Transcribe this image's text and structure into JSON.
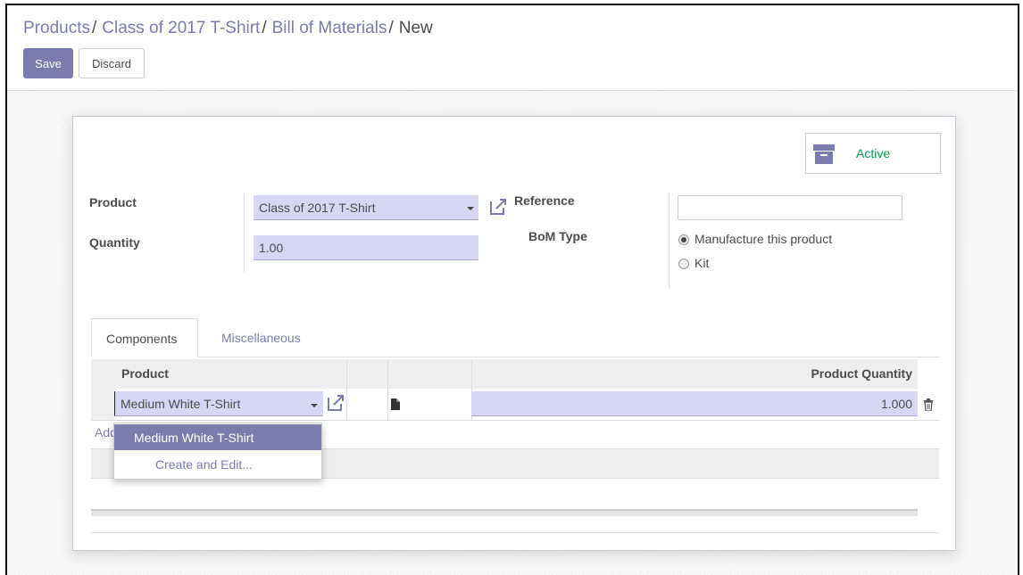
{
  "breadcrumb": {
    "items": [
      "Products",
      "Class of 2017 T-Shirt",
      "Bill of Materials"
    ],
    "current": "New",
    "separator": "/"
  },
  "toolbar": {
    "save_label": "Save",
    "discard_label": "Discard"
  },
  "status": {
    "active_label": "Active",
    "active_icon": "archive-icon"
  },
  "form": {
    "product_label": "Product",
    "product_value": "Class of 2017 T-Shirt",
    "quantity_label": "Quantity",
    "quantity_value": "1.00",
    "reference_label": "Reference",
    "reference_value": "",
    "bom_type_label": "BoM Type",
    "bom_type_options": [
      "Manufacture this product",
      "Kit"
    ],
    "bom_type_selected": "Manufacture this product"
  },
  "tabs": [
    {
      "label": "Components",
      "active": true
    },
    {
      "label": "Miscellaneous",
      "active": false
    }
  ],
  "components": {
    "columns": [
      "Product",
      "Product Quantity"
    ],
    "rows": [
      {
        "product": "Medium White T-Shirt",
        "quantity": "1.000"
      }
    ],
    "add_line_label": "Add"
  },
  "dropdown": {
    "items": [
      "Medium White T-Shirt"
    ],
    "create_label": "Create and Edit..."
  },
  "colors": {
    "accent": "#7c7bad",
    "input_bg": "#d7d6f5",
    "active_green": "#00a04a"
  }
}
